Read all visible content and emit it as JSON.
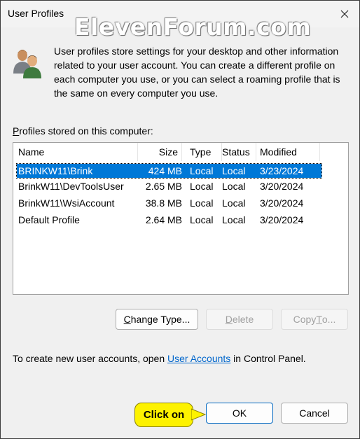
{
  "window": {
    "title": "User Profiles",
    "watermark": "ElevenForum.com"
  },
  "intro": {
    "text": "User profiles store settings for your desktop and other information related to your user account. You can create a different profile on each computer you use, or you can select a roaming profile that is the same on every computer you use."
  },
  "profiles": {
    "label_access": "P",
    "label_rest": "rofiles stored on this computer:",
    "columns": {
      "name": "Name",
      "size": "Size",
      "type": "Type",
      "status": "Status",
      "modified": "Modified"
    },
    "rows": [
      {
        "name": "BRINKW11\\Brink",
        "size": "424 MB",
        "type": "Local",
        "status": "Local",
        "modified": "3/23/2024",
        "selected": true
      },
      {
        "name": "BrinkW11\\DevToolsUser",
        "size": "2.65 MB",
        "type": "Local",
        "status": "Local",
        "modified": "3/20/2024"
      },
      {
        "name": "BrinkW11\\WsiAccount",
        "size": "38.8 MB",
        "type": "Local",
        "status": "Local",
        "modified": "3/20/2024"
      },
      {
        "name": "Default Profile",
        "size": "2.64 MB",
        "type": "Local",
        "status": "Local",
        "modified": "3/20/2024"
      }
    ]
  },
  "buttons": {
    "change_type_access": "C",
    "change_type_rest": "hange Type...",
    "delete_access": "D",
    "delete_rest": "elete",
    "copy_to_pre": "Copy ",
    "copy_to_access": "T",
    "copy_to_rest": "o...",
    "ok": "OK",
    "cancel": "Cancel"
  },
  "footer": {
    "prefix": "To create new user accounts, open ",
    "link": "User Accounts",
    "suffix": " in Control Panel."
  },
  "callout": {
    "text": "Click on"
  },
  "colors": {
    "selection": "#0078d7",
    "link": "#0066cc",
    "callout": "#fdf200"
  }
}
